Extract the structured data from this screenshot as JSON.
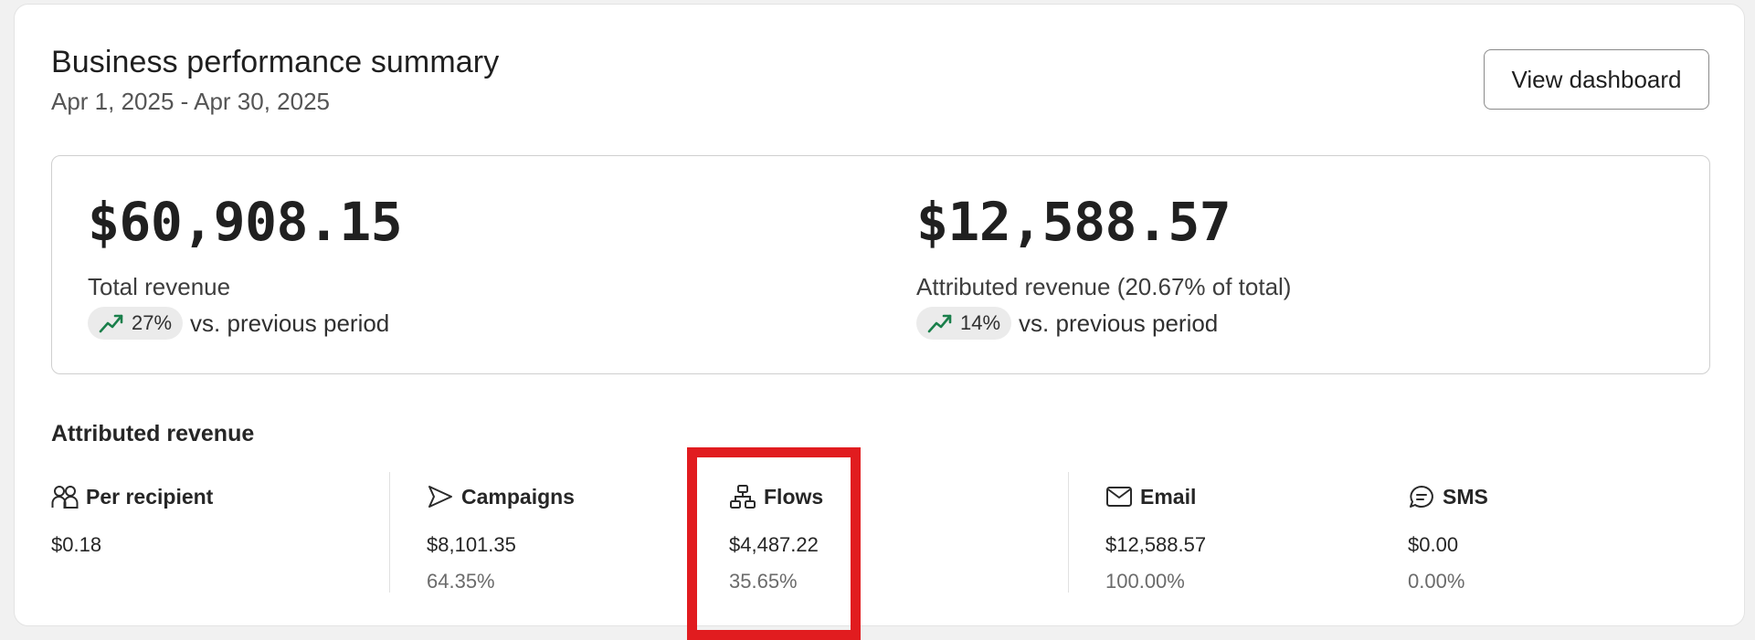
{
  "header": {
    "title": "Business performance summary",
    "date_range": "Apr 1, 2025 - Apr 30, 2025",
    "view_dashboard_label": "View dashboard"
  },
  "summary": {
    "total": {
      "value": "$60,908.15",
      "label": "Total revenue",
      "trend_percent": "27%",
      "trend_text": "vs. previous period"
    },
    "attributed": {
      "value": "$12,588.57",
      "label": "Attributed revenue (20.67% of total)",
      "trend_percent": "14%",
      "trend_text": "vs. previous period"
    }
  },
  "attributed_section": {
    "heading": "Attributed revenue",
    "columns": [
      {
        "icon": "users-icon",
        "label": "Per recipient",
        "value": "$0.18",
        "percent": ""
      },
      {
        "icon": "send-icon",
        "label": "Campaigns",
        "value": "$8,101.35",
        "percent": "64.35%"
      },
      {
        "icon": "flows-icon",
        "label": "Flows",
        "value": "$4,487.22",
        "percent": "35.65%"
      },
      {
        "icon": "mail-icon",
        "label": "Email",
        "value": "$12,588.57",
        "percent": "100.00%"
      },
      {
        "icon": "chat-icon",
        "label": "SMS",
        "value": "$0.00",
        "percent": "0.00%"
      }
    ]
  },
  "colors": {
    "trend_up": "#1a7f4b",
    "highlight": "#e11c1f",
    "pill_bg": "#ebebeb"
  }
}
